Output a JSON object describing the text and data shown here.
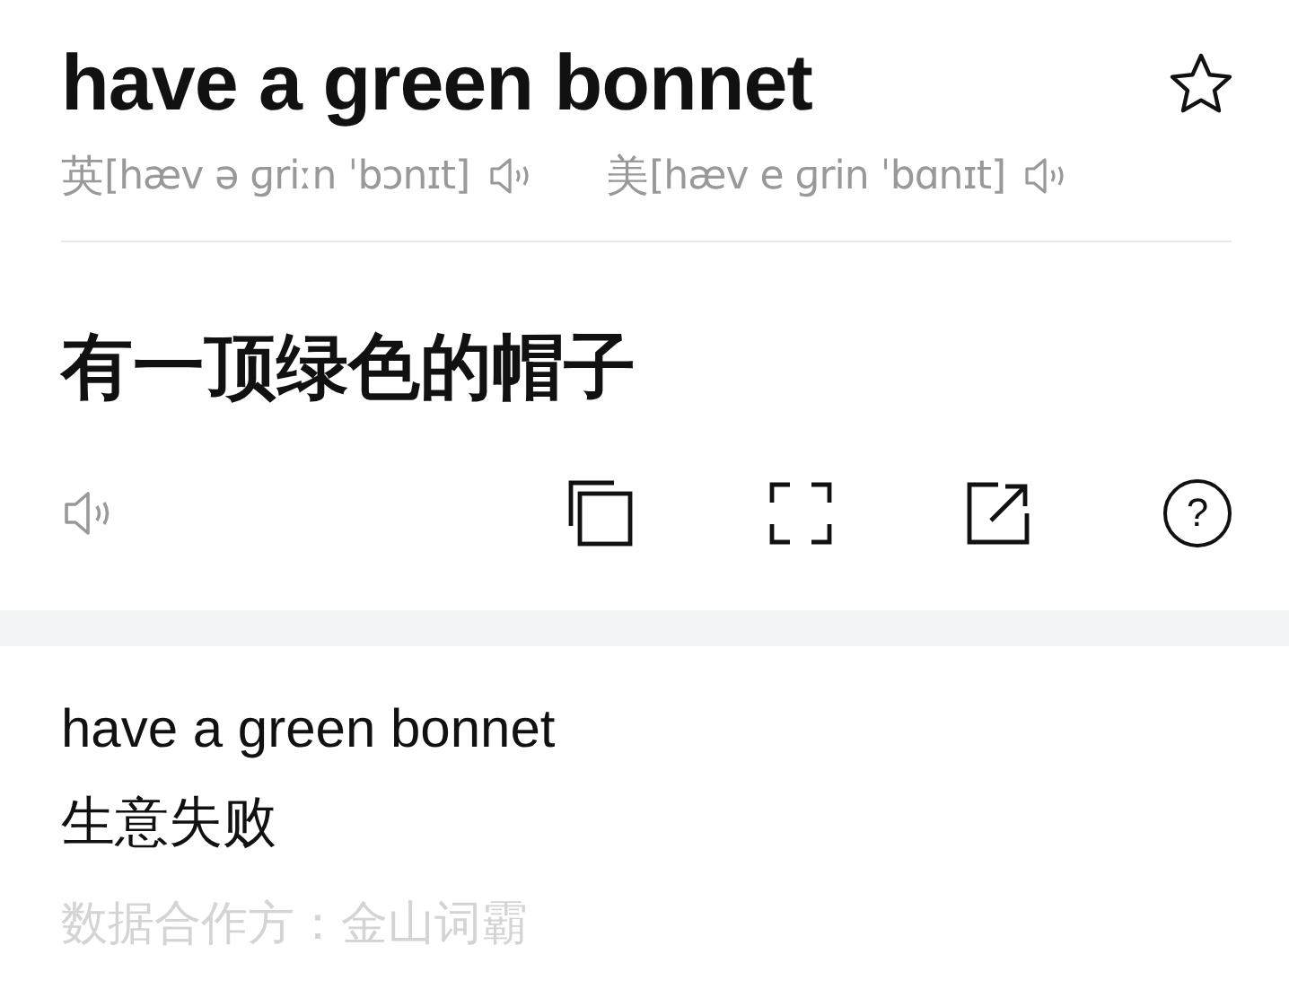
{
  "headword": "have a green bonnet",
  "pronunciations": [
    {
      "region": "英",
      "phonetic": "[hæv ə ɡriːn ˈbɔnɪt]"
    },
    {
      "region": "美",
      "phonetic": "[hæv e ɡrin ˈbɑnɪt]"
    }
  ],
  "translation": "有一顶绿色的帽子",
  "help_label": "?",
  "result": {
    "phrase": "have a green bonnet",
    "meaning": "生意失败",
    "source": "数据合作方：金山词霸"
  }
}
